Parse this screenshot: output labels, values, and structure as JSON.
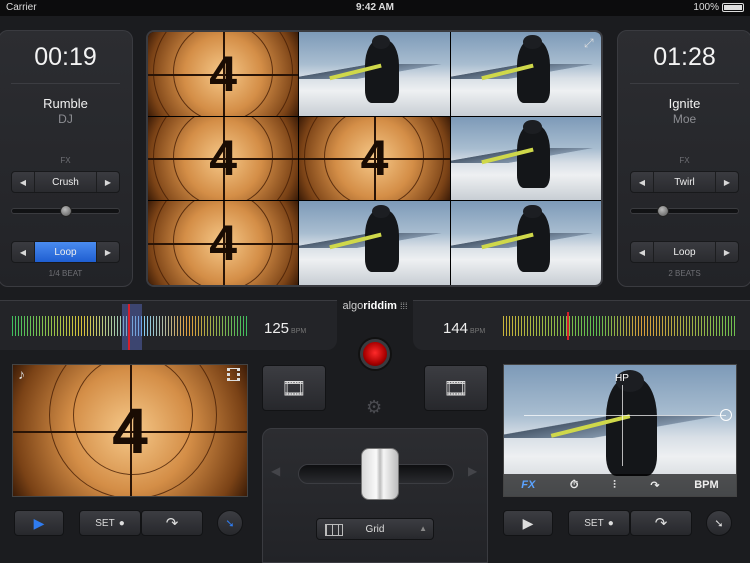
{
  "status": {
    "carrier": "Carrier",
    "time": "9:42 AM",
    "battery": "100%"
  },
  "left_deck": {
    "time": "00:19",
    "title": "Rumble",
    "artist": "DJ",
    "fx_label": "FX",
    "fx_selected": "Crush",
    "fx_slider": 0.5,
    "loop_selected": "Loop",
    "loop_sub": "1/4 BEAT",
    "bpm": "125",
    "bpm_unit": "BPM",
    "thumb_digit": "4"
  },
  "right_deck": {
    "time": "01:28",
    "title": "Ignite",
    "artist": "Moe",
    "fx_label": "FX",
    "fx_selected": "Twirl",
    "fx_slider": 0.3,
    "loop_selected": "Loop",
    "loop_sub": "2 BEATS",
    "bpm": "144",
    "bpm_unit": "BPM",
    "hp_label": "HP",
    "fx_bar": {
      "fx": "FX",
      "bpm": "BPM"
    }
  },
  "center": {
    "logo_a": "algo",
    "logo_b": "riddim",
    "grid_label": "Grid",
    "video_grid": [
      {
        "type": "countdown",
        "digit": "4"
      },
      {
        "type": "snow"
      },
      {
        "type": "snow"
      },
      {
        "type": "countdown",
        "digit": "4"
      },
      {
        "type": "countdown",
        "digit": "4"
      },
      {
        "type": "snow"
      },
      {
        "type": "countdown",
        "digit": "4"
      },
      {
        "type": "snow"
      },
      {
        "type": "snow"
      }
    ]
  },
  "transport": {
    "set_label": "SET"
  },
  "colors": {
    "accent": "#2f7cf0",
    "record": "#e11b1b",
    "waveform_left": "#3fbf5f",
    "playhead": "#d61e2b"
  }
}
